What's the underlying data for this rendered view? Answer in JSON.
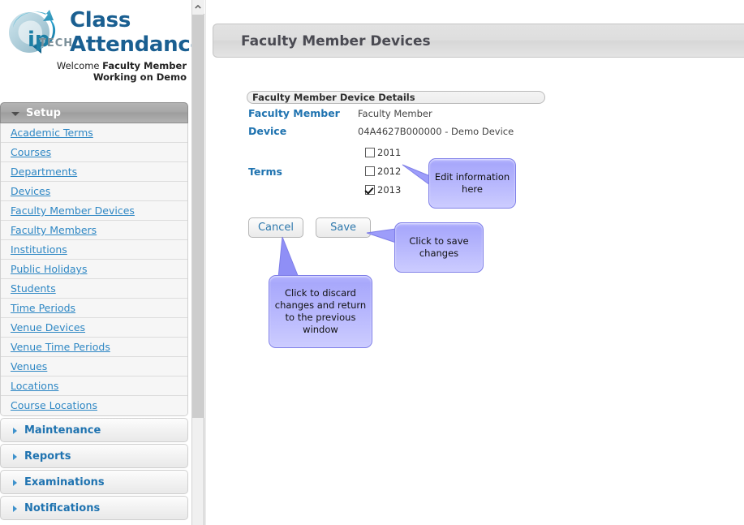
{
  "brand": {
    "logo_icon": "iptech-globe-logo",
    "title": "Class Attendance",
    "welcome_prefix": "Welcome ",
    "welcome_name": "Faculty Member",
    "welcome_line2": "Working on Demo"
  },
  "sidebar": {
    "scroll_up_icon": "chevron-up-icon",
    "sections": [
      {
        "label": "Setup",
        "state": "expanded",
        "icon": "chevron-down-icon",
        "items": [
          {
            "label": "Academic Terms"
          },
          {
            "label": "Courses"
          },
          {
            "label": "Departments"
          },
          {
            "label": "Devices"
          },
          {
            "label": "Faculty Member Devices"
          },
          {
            "label": "Faculty Members"
          },
          {
            "label": "Institutions"
          },
          {
            "label": "Public Holidays"
          },
          {
            "label": "Students"
          },
          {
            "label": "Time Periods"
          },
          {
            "label": "Venue Devices"
          },
          {
            "label": "Venue Time Periods"
          },
          {
            "label": "Venues"
          },
          {
            "label": "Locations"
          },
          {
            "label": "Course Locations"
          }
        ]
      },
      {
        "label": "Maintenance",
        "state": "collapsed",
        "icon": "chevron-right-icon"
      },
      {
        "label": "Reports",
        "state": "collapsed",
        "icon": "chevron-right-icon"
      },
      {
        "label": "Examinations",
        "state": "collapsed",
        "icon": "chevron-right-icon"
      },
      {
        "label": "Notifications",
        "state": "collapsed",
        "icon": "chevron-right-icon"
      }
    ]
  },
  "main": {
    "page_title": "Faculty Member Devices",
    "fieldset": {
      "legend": "Faculty Member Device Details",
      "rows": [
        {
          "label": "Faculty Member",
          "value": "Faculty Member"
        },
        {
          "label": "Device",
          "value": "04A4627B000000 - Demo Device"
        }
      ],
      "terms": {
        "label": "Terms",
        "options": [
          {
            "label": "2011",
            "checked": false
          },
          {
            "label": "2012",
            "checked": false
          },
          {
            "label": "2013",
            "checked": true
          }
        ]
      }
    },
    "buttons": {
      "cancel": "Cancel",
      "save": "Save"
    }
  },
  "callouts": [
    {
      "id": "edit",
      "text": "Edit information here"
    },
    {
      "id": "save",
      "text": "Click to save changes"
    },
    {
      "id": "cancel",
      "text": "Click to discard changes and return to the previous window"
    }
  ]
}
